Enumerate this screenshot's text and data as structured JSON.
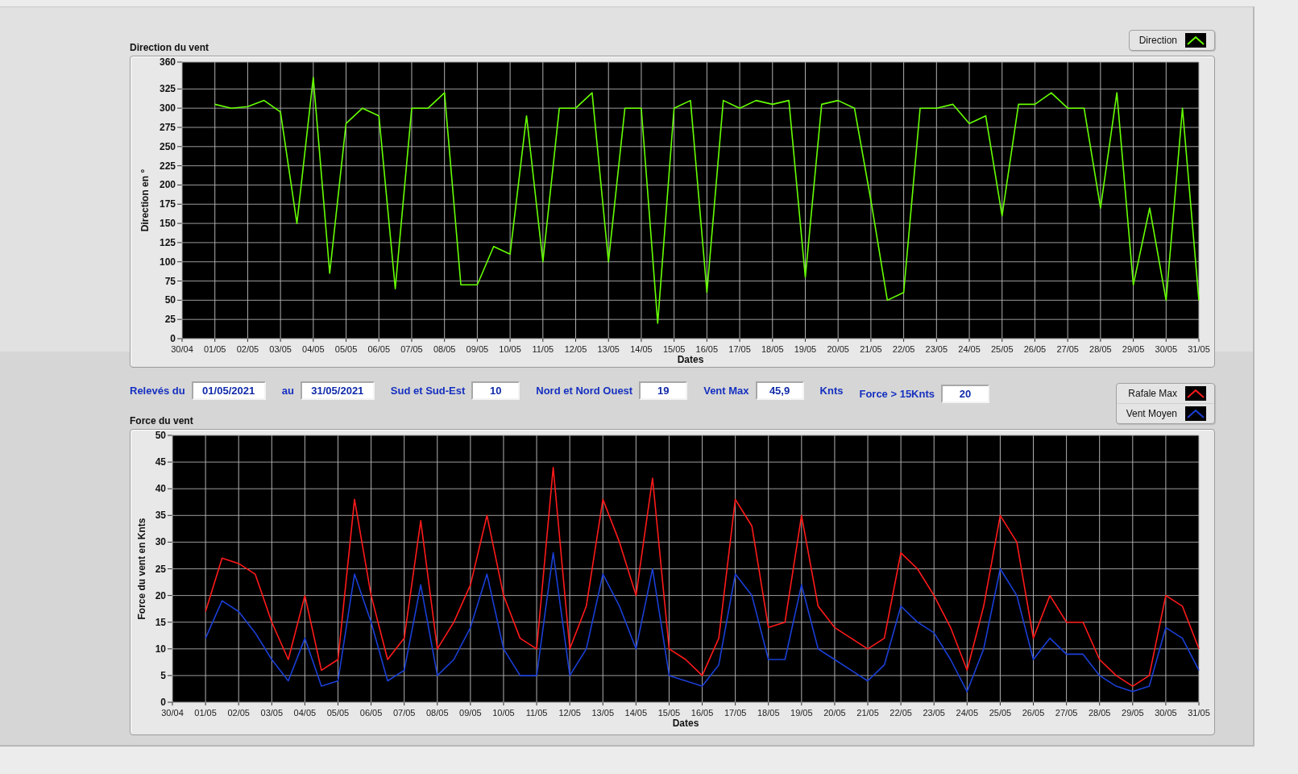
{
  "direction_chart": {
    "chart_data": {
      "type": "line",
      "title": "Direction du vent",
      "xlabel": "Dates",
      "ylabel": "Direction en °",
      "grid": true,
      "ylim": [
        0,
        360
      ],
      "yticks": [
        0,
        25,
        50,
        75,
        100,
        125,
        150,
        175,
        200,
        225,
        250,
        275,
        300,
        325,
        360
      ],
      "categories": [
        "30/04",
        null,
        "01/05",
        null,
        "02/05",
        null,
        "03/05",
        null,
        "04/05",
        null,
        "05/05",
        null,
        "06/05",
        null,
        "07/05",
        null,
        "08/05",
        null,
        "09/05",
        null,
        "10/05",
        null,
        "11/05",
        null,
        "12/05",
        null,
        "13/05",
        null,
        "14/05",
        null,
        "15/05",
        null,
        "16/05",
        null,
        "17/05",
        null,
        "18/05",
        null,
        "19/05",
        null,
        "20/05",
        null,
        "21/05",
        null,
        "22/05",
        null,
        "23/05",
        null,
        "24/05",
        null,
        "25/05",
        null,
        "26/05",
        null,
        "27/05",
        null,
        "28/05",
        null,
        "29/05",
        null,
        "30/05",
        null,
        "31/05"
      ],
      "series": [
        {
          "name": "Direction",
          "color": "#66ff00",
          "values": [
            null,
            null,
            305,
            300,
            302,
            310,
            295,
            150,
            340,
            85,
            280,
            300,
            290,
            65,
            300,
            300,
            320,
            70,
            70,
            120,
            110,
            290,
            100,
            300,
            300,
            320,
            100,
            300,
            300,
            20,
            300,
            310,
            60,
            310,
            300,
            310,
            305,
            310,
            80,
            305,
            310,
            300,
            180,
            50,
            60,
            300,
            300,
            305,
            280,
            290,
            160,
            305,
            305,
            320,
            300,
            300,
            170,
            320,
            70,
            170,
            50,
            300,
            50
          ]
        }
      ]
    }
  },
  "filters": [
    {
      "label": "Relevés du",
      "value": "01/05/2021"
    },
    {
      "label": "au",
      "value": "31/05/2021"
    },
    {
      "label": "Sud et Sud-Est",
      "value": "10"
    },
    {
      "label": "Nord et Nord Ouest",
      "value": "19"
    },
    {
      "label": "Vent Max",
      "value": "45,9",
      "unit": "Knts"
    },
    {
      "label": "Force > 15Knts",
      "value": "20"
    }
  ],
  "force_chart": {
    "chart_data": {
      "type": "line",
      "title": "Force du vent",
      "xlabel": "Dates",
      "ylabel": "Force du vent en Knts",
      "grid": true,
      "ylim": [
        0,
        50
      ],
      "yticks": [
        0,
        5,
        10,
        15,
        20,
        25,
        30,
        35,
        40,
        45,
        50
      ],
      "categories": [
        "30/04",
        null,
        "01/05",
        null,
        "02/05",
        null,
        "03/05",
        null,
        "04/05",
        null,
        "05/05",
        null,
        "06/05",
        null,
        "07/05",
        null,
        "08/05",
        null,
        "09/05",
        null,
        "10/05",
        null,
        "11/05",
        null,
        "12/05",
        null,
        "13/05",
        null,
        "14/05",
        null,
        "15/05",
        null,
        "16/05",
        null,
        "17/05",
        null,
        "18/05",
        null,
        "19/05",
        null,
        "20/05",
        null,
        "21/05",
        null,
        "22/05",
        null,
        "23/05",
        null,
        "24/05",
        null,
        "25/05",
        null,
        "26/05",
        null,
        "27/05",
        null,
        "28/05",
        null,
        "29/05",
        null,
        "30/05",
        null,
        "31/05"
      ],
      "series": [
        {
          "name": "Rafale Max",
          "color": "#ff1a1a",
          "values": [
            null,
            null,
            17,
            27,
            26,
            24,
            15,
            8,
            20,
            6,
            8,
            38,
            20,
            8,
            12,
            34,
            10,
            15,
            22,
            35,
            20,
            12,
            10,
            44,
            10,
            18,
            38,
            30,
            20,
            42,
            10,
            8,
            5,
            12,
            38,
            33,
            14,
            15,
            35,
            18,
            14,
            12,
            10,
            12,
            28,
            25,
            20,
            14,
            6,
            18,
            35,
            30,
            12,
            20,
            15,
            15,
            8,
            5,
            3,
            5,
            20,
            18,
            10
          ]
        },
        {
          "name": "Vent Moyen",
          "color": "#1a3fd6",
          "values": [
            null,
            null,
            12,
            19,
            17,
            13,
            8,
            4,
            12,
            3,
            4,
            24,
            15,
            4,
            6,
            22,
            5,
            8,
            14,
            24,
            10,
            5,
            5,
            28,
            5,
            10,
            24,
            18,
            10,
            25,
            5,
            4,
            3,
            7,
            24,
            20,
            8,
            8,
            22,
            10,
            8,
            6,
            4,
            7,
            18,
            15,
            13,
            8,
            2,
            10,
            25,
            20,
            8,
            12,
            9,
            9,
            5,
            3,
            2,
            3,
            14,
            12,
            6
          ]
        }
      ]
    }
  }
}
